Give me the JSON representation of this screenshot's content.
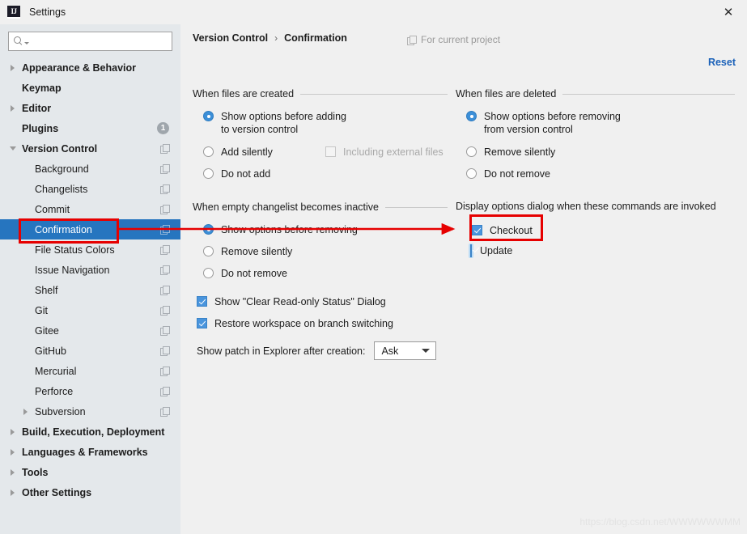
{
  "window": {
    "title": "Settings",
    "logo_text": "IJ",
    "close_label": "✕"
  },
  "sidebar": {
    "search": {
      "value": "",
      "placeholder": ""
    },
    "items": [
      {
        "label": "Appearance & Behavior",
        "level": 0,
        "arrow": "right",
        "icon": null,
        "badge": null,
        "selected": false
      },
      {
        "label": "Keymap",
        "level": 0,
        "arrow": "none",
        "icon": null,
        "badge": null,
        "selected": false
      },
      {
        "label": "Editor",
        "level": 0,
        "arrow": "right",
        "icon": null,
        "badge": null,
        "selected": false
      },
      {
        "label": "Plugins",
        "level": 0,
        "arrow": "none",
        "icon": null,
        "badge": "1",
        "selected": false
      },
      {
        "label": "Version Control",
        "level": 0,
        "arrow": "down",
        "icon": "copy-icon",
        "badge": null,
        "selected": false
      },
      {
        "label": "Background",
        "level": 1,
        "arrow": "none",
        "icon": "copy-icon",
        "badge": null,
        "selected": false
      },
      {
        "label": "Changelists",
        "level": 1,
        "arrow": "none",
        "icon": "copy-icon",
        "badge": null,
        "selected": false
      },
      {
        "label": "Commit",
        "level": 1,
        "arrow": "none",
        "icon": "copy-icon",
        "badge": null,
        "selected": false
      },
      {
        "label": "Confirmation",
        "level": 1,
        "arrow": "none",
        "icon": "copy-icon",
        "badge": null,
        "selected": true
      },
      {
        "label": "File Status Colors",
        "level": 1,
        "arrow": "none",
        "icon": "copy-icon",
        "badge": null,
        "selected": false
      },
      {
        "label": "Issue Navigation",
        "level": 1,
        "arrow": "none",
        "icon": "copy-icon",
        "badge": null,
        "selected": false
      },
      {
        "label": "Shelf",
        "level": 1,
        "arrow": "none",
        "icon": "copy-icon",
        "badge": null,
        "selected": false
      },
      {
        "label": "Git",
        "level": 1,
        "arrow": "none",
        "icon": "copy-icon",
        "badge": null,
        "selected": false
      },
      {
        "label": "Gitee",
        "level": 1,
        "arrow": "none",
        "icon": "copy-icon",
        "badge": null,
        "selected": false
      },
      {
        "label": "GitHub",
        "level": 1,
        "arrow": "none",
        "icon": "copy-icon",
        "badge": null,
        "selected": false
      },
      {
        "label": "Mercurial",
        "level": 1,
        "arrow": "none",
        "icon": "copy-icon",
        "badge": null,
        "selected": false
      },
      {
        "label": "Perforce",
        "level": 1,
        "arrow": "none",
        "icon": "copy-icon",
        "badge": null,
        "selected": false
      },
      {
        "label": "Subversion",
        "level": 1,
        "arrow": "right",
        "icon": "copy-icon",
        "badge": null,
        "selected": false
      },
      {
        "label": "Build, Execution, Deployment",
        "level": 0,
        "arrow": "right",
        "icon": null,
        "badge": null,
        "selected": false
      },
      {
        "label": "Languages & Frameworks",
        "level": 0,
        "arrow": "right",
        "icon": null,
        "badge": null,
        "selected": false
      },
      {
        "label": "Tools",
        "level": 0,
        "arrow": "right",
        "icon": null,
        "badge": null,
        "selected": false
      },
      {
        "label": "Other Settings",
        "level": 0,
        "arrow": "right",
        "icon": null,
        "badge": null,
        "selected": false
      }
    ]
  },
  "main": {
    "breadcrumb": {
      "parent": "Version Control",
      "separator": "›",
      "current": "Confirmation"
    },
    "for_current_project": "For current project",
    "reset_label": "Reset",
    "sections": {
      "files_created": {
        "title": "When files are created",
        "options": [
          {
            "label": "Show options before adding\nto version control",
            "checked": true
          },
          {
            "label": "Add silently",
            "checked": false
          },
          {
            "label": "Do not add",
            "checked": false
          }
        ],
        "extra_checkbox": {
          "label": "Including external files",
          "checked": false,
          "disabled": true
        }
      },
      "files_deleted": {
        "title": "When files are deleted",
        "options": [
          {
            "label": "Show options before removing\nfrom version control",
            "checked": true
          },
          {
            "label": "Remove silently",
            "checked": false
          },
          {
            "label": "Do not remove",
            "checked": false
          }
        ]
      },
      "empty_changelist": {
        "title": "When empty changelist becomes inactive",
        "options": [
          {
            "label": "Show options before removing",
            "checked": true
          },
          {
            "label": "Remove silently",
            "checked": false
          },
          {
            "label": "Do not remove",
            "checked": false
          }
        ]
      },
      "display_options": {
        "title": "Display options dialog when these commands are invoked",
        "checkboxes": [
          {
            "label": "Checkout",
            "checked": true,
            "focused": false
          },
          {
            "label": "Update",
            "checked": true,
            "focused": true
          }
        ]
      }
    },
    "bottom_checkboxes": [
      {
        "label": "Show \"Clear Read-only Status\" Dialog",
        "checked": true
      },
      {
        "label": "Restore workspace on branch switching",
        "checked": true
      }
    ],
    "patch_row": {
      "label": "Show patch in Explorer after creation:",
      "value": "Ask"
    }
  },
  "annotations": {
    "highlight_color": "#e60000",
    "arrow_color": "#e60000"
  },
  "watermark": "https://blog.csdn.net/WWWWWWMM"
}
